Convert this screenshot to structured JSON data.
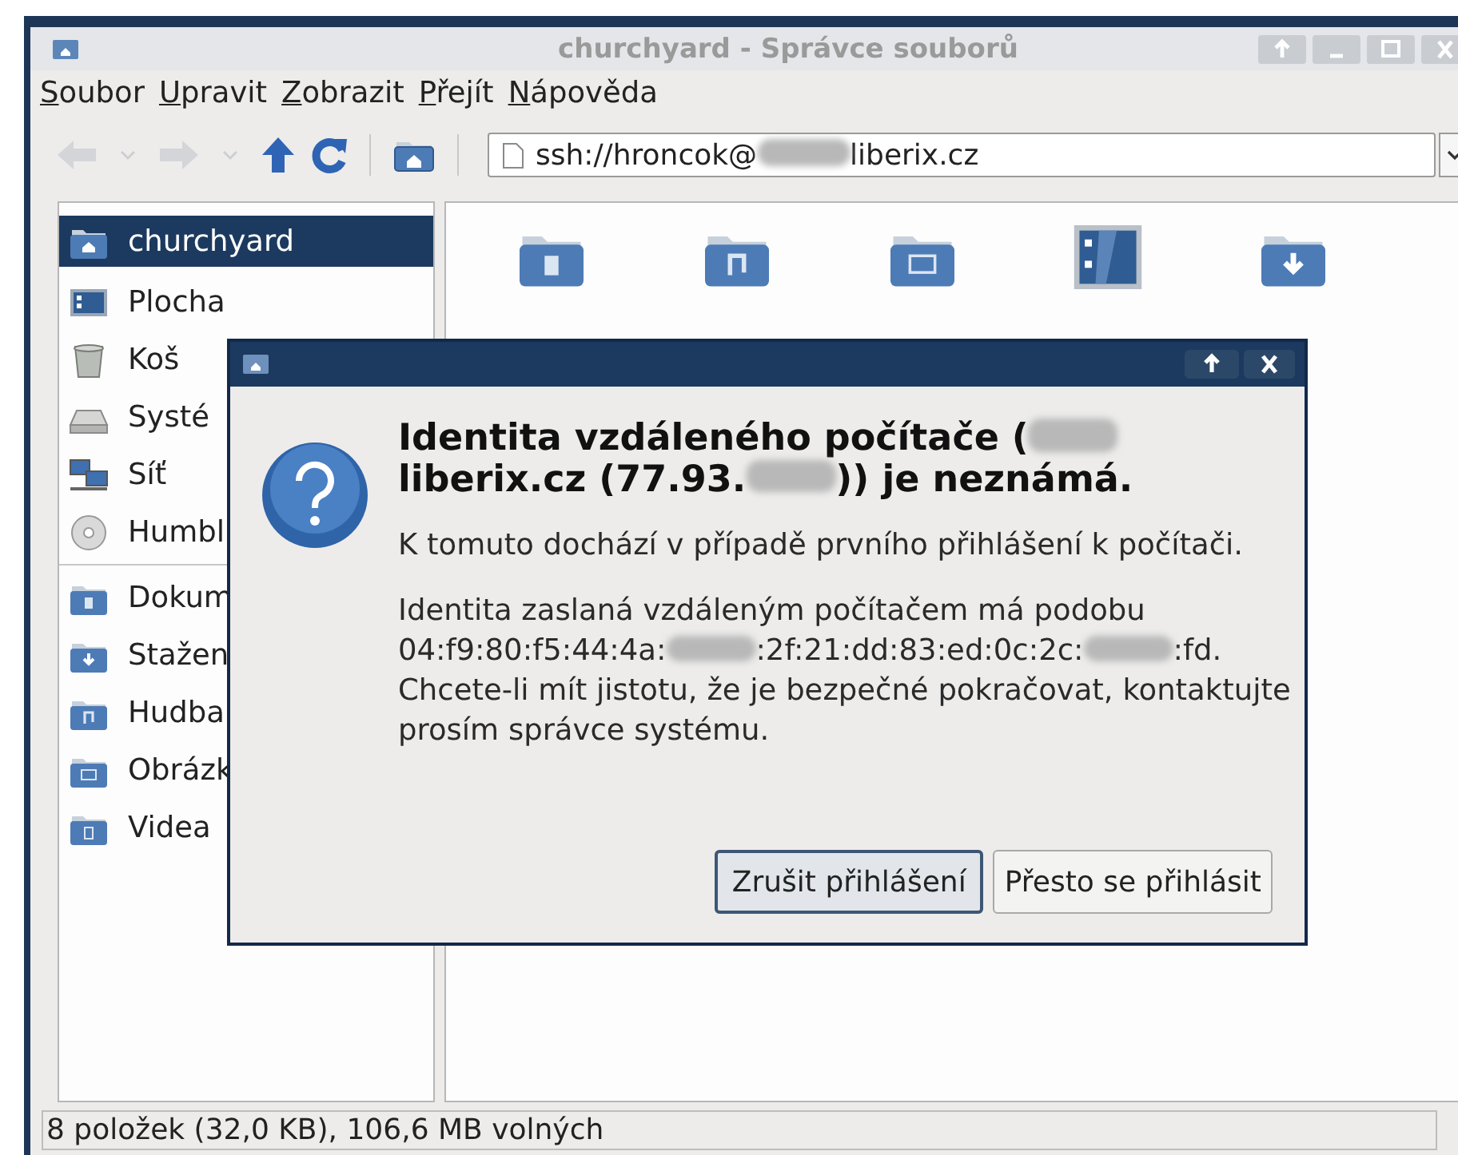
{
  "window": {
    "title": "churchyard - Správce souborů"
  },
  "menu": [
    {
      "label": "Soubor"
    },
    {
      "label": "Upravit"
    },
    {
      "label": "Zobrazit"
    },
    {
      "label": "Přejít"
    },
    {
      "label": "Nápověda"
    }
  ],
  "toolbar": [
    {
      "kind": "back",
      "disabled": true
    },
    {
      "kind": "history",
      "disabled": true
    },
    {
      "kind": "forward",
      "disabled": true
    },
    {
      "kind": "history",
      "disabled": true
    },
    {
      "kind": "up",
      "disabled": false
    },
    {
      "kind": "reload",
      "disabled": false
    },
    {
      "kind": "separator"
    },
    {
      "kind": "home"
    },
    {
      "kind": "separator"
    }
  ],
  "location": [
    {
      "kind": "text",
      "text": "ssh://hroncok@"
    },
    {
      "kind": "redacted"
    },
    {
      "kind": "text",
      "text": "liberix.cz"
    }
  ],
  "sidebar": {
    "groups": [
      [
        {
          "kind": "home",
          "label": "churchyard",
          "selected": true
        },
        {
          "kind": "desktop",
          "label": "Plocha",
          "selected": false
        },
        {
          "kind": "trash",
          "label": "Koš",
          "selected": false
        },
        {
          "kind": "drive",
          "label": "Systé",
          "selected": false
        },
        {
          "kind": "network",
          "label": "Síť",
          "selected": false
        },
        {
          "kind": "disc",
          "label": "Humbl",
          "selected": false
        }
      ],
      [
        {
          "kind": "documents",
          "label": "Dokum",
          "selected": false
        },
        {
          "kind": "downloads",
          "label": "Stažen",
          "selected": false
        },
        {
          "kind": "music",
          "label": "Hudba",
          "selected": false
        },
        {
          "kind": "pictures",
          "label": "Obrázk",
          "selected": false
        },
        {
          "kind": "videos",
          "label": "Videa",
          "selected": false
        }
      ]
    ]
  },
  "files": [
    {
      "kind": "documents"
    },
    {
      "kind": "music"
    },
    {
      "kind": "pictures"
    },
    {
      "kind": "desktop"
    },
    {
      "kind": "downloads"
    }
  ],
  "dialog": {
    "heading": [
      {
        "kind": "text",
        "text": "Identita vzdáleného počítače ("
      },
      {
        "kind": "redacted"
      },
      {
        "kind": "text",
        "text": " liberix.cz (77.93."
      },
      {
        "kind": "redacted"
      },
      {
        "kind": "text",
        "text": ")) je neznámá."
      }
    ],
    "message": "K tomuto dochází v případě prvního přihlášení k počítači.",
    "details": [
      {
        "kind": "text",
        "text": "Identita zaslaná vzdáleným počítačem má podobu 04:f9:80:f5:44:4a:"
      },
      {
        "kind": "redacted"
      },
      {
        "kind": "text",
        "text": ":2f:21:dd:83:ed:0c:2c:"
      },
      {
        "kind": "redacted"
      },
      {
        "kind": "text",
        "text": ":fd. Chcete-li mít jistotu, že je bezpečné pokračovat, kontaktujte prosím správce systému."
      }
    ],
    "buttons": [
      {
        "label": "Zrušit přihlášení",
        "focused": true
      },
      {
        "label": "Přesto se přihlásit",
        "focused": false
      }
    ]
  },
  "status_bar": "8 položek (32,0 KB), 106,6 MB volných"
}
